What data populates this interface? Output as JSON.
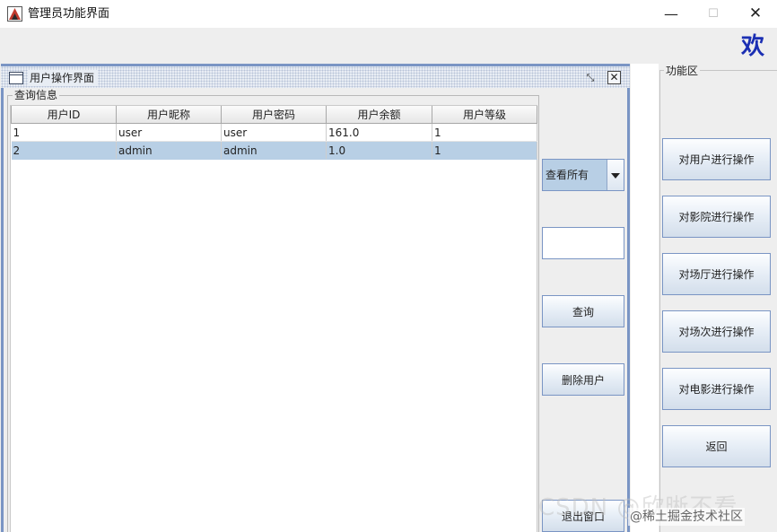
{
  "window": {
    "title": "管理员功能界面",
    "minimize_glyph": "—",
    "maximize_glyph": "☐",
    "close_glyph": "✕"
  },
  "welcome_text": "欢",
  "internal_frame": {
    "title": "用户操作界面",
    "icon": "window-icon",
    "restore_glyph": "⤡",
    "close_glyph": "✕"
  },
  "query_group": {
    "legend": "查询信息",
    "columns": [
      "用户ID",
      "用户昵称",
      "用户密码",
      "用户余额",
      "用户等级"
    ],
    "rows": [
      [
        "1",
        "user",
        "user",
        "161.0",
        "1"
      ],
      [
        "2",
        "admin",
        "admin",
        "1.0",
        "1"
      ]
    ],
    "selected_row": 2
  },
  "controls": {
    "filter_selected": "查看所有",
    "search_value": "",
    "query_button": "查询",
    "delete_button": "删除用户",
    "exit_button": "退出窗口"
  },
  "function_area": {
    "legend": "功能区",
    "buttons": [
      "对用户进行操作",
      "对影院进行操作",
      "对场厅进行操作",
      "对场次进行操作",
      "对电影进行操作",
      "返回"
    ]
  },
  "watermark": {
    "faint_text": "CSDN @欣晰不看",
    "text": "@稀土掘金技术社区"
  },
  "colors": {
    "frame_border": "#7a95c4",
    "selection": "#b8cfe5",
    "welcome": "#1b2fb3"
  }
}
